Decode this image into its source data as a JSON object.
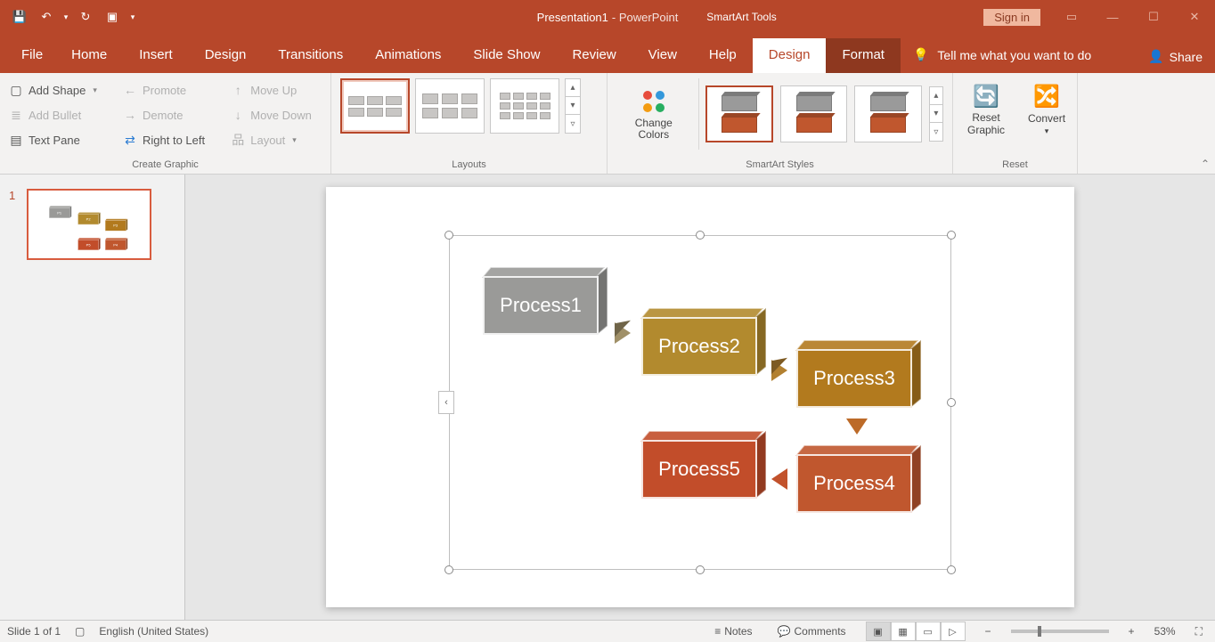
{
  "titlebar": {
    "doc_name": "Presentation1",
    "app_suffix": " -  PowerPoint",
    "tool_context": "SmartArt Tools",
    "signin": "Sign in"
  },
  "tabs": {
    "file": "File",
    "home": "Home",
    "insert": "Insert",
    "design_main": "Design",
    "transitions": "Transitions",
    "animations": "Animations",
    "slideshow": "Slide Show",
    "review": "Review",
    "view": "View",
    "help": "Help",
    "sa_design": "Design",
    "sa_format": "Format",
    "tell_me": "Tell me what you want to do",
    "share": "Share"
  },
  "groups": {
    "create_graphic": {
      "label": "Create Graphic",
      "add_shape": "Add Shape",
      "add_bullet": "Add Bullet",
      "text_pane": "Text Pane",
      "promote": "Promote",
      "demote": "Demote",
      "rtl": "Right to Left",
      "move_up": "Move Up",
      "move_down": "Move Down",
      "layout": "Layout"
    },
    "layouts": {
      "label": "Layouts"
    },
    "sa_styles": {
      "label": "SmartArt Styles",
      "change_colors": "Change Colors"
    },
    "reset": {
      "label": "Reset",
      "reset_graphic": "Reset Graphic",
      "convert": "Convert"
    }
  },
  "smartart": {
    "p1": "Process1",
    "p2": "Process2",
    "p3": "Process3",
    "p4": "Process4",
    "p5": "Process5"
  },
  "thumbnail": {
    "num": "1"
  },
  "status": {
    "slide_info": "Slide 1 of 1",
    "language": "English (United States)",
    "notes": "Notes",
    "comments": "Comments",
    "zoom": "53%"
  }
}
